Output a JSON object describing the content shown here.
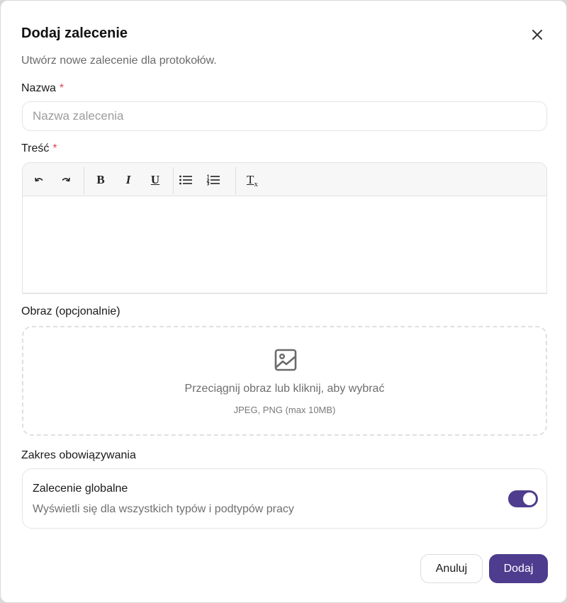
{
  "dialog": {
    "title": "Dodaj zalecenie",
    "subtitle": "Utwórz nowe zalecenie dla protokołów."
  },
  "name_field": {
    "label": "Nazwa",
    "required_mark": "*",
    "placeholder": "Nazwa zalecenia",
    "value": ""
  },
  "content_field": {
    "label": "Treść",
    "required_mark": "*",
    "toolbar": {
      "undo_icon": "undo-icon",
      "redo_icon": "redo-icon",
      "bold_glyph": "B",
      "italic_glyph": "I",
      "underline_glyph": "U",
      "bullet_list_icon": "bullet-list-icon",
      "numbered_list_icon": "numbered-list-icon",
      "clear_format_glyph": "T",
      "clear_format_sub": "x"
    }
  },
  "image_field": {
    "label": "Obraz (opcjonalnie)",
    "icon": "image-icon",
    "dropzone_text": "Przeciągnij obraz lub kliknij, aby wybrać",
    "dropzone_hint": "JPEG, PNG (max 10MB)"
  },
  "scope": {
    "label": "Zakres obowiązywania",
    "option_title": "Zalecenie globalne",
    "option_desc": "Wyświetli się dla wszystkich typów i podtypów pracy",
    "enabled": true
  },
  "actions": {
    "cancel_label": "Anuluj",
    "submit_label": "Dodaj"
  },
  "colors": {
    "primary": "#4e3c8e",
    "required": "#e0455b"
  }
}
